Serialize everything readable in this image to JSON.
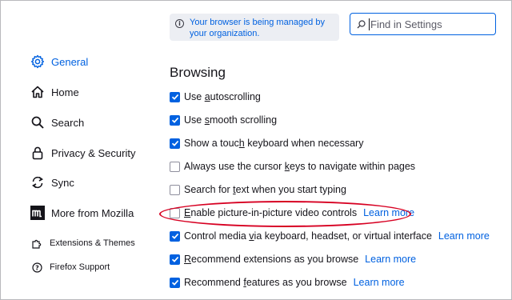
{
  "banner": {
    "text": "Your browser is being managed by your organization."
  },
  "search": {
    "placeholder": "Find in Settings"
  },
  "sidebar": {
    "items": [
      {
        "label": "General",
        "icon": "gear-icon",
        "selected": true
      },
      {
        "label": "Home",
        "icon": "home-icon"
      },
      {
        "label": "Search",
        "icon": "search-icon"
      },
      {
        "label": "Privacy & Security",
        "icon": "lock-icon"
      },
      {
        "label": "Sync",
        "icon": "sync-icon"
      },
      {
        "label": "More from Mozilla",
        "icon": "mozilla-icon"
      }
    ],
    "footer": [
      {
        "label": "Extensions & Themes",
        "icon": "puzzle-icon"
      },
      {
        "label": "Firefox Support",
        "icon": "help-icon"
      }
    ]
  },
  "browsing": {
    "heading": "Browsing",
    "options": [
      {
        "pre": "Use ",
        "key": "a",
        "post": "utoscrolling",
        "checked": true
      },
      {
        "pre": "Use ",
        "key": "s",
        "post": "mooth scrolling",
        "checked": true
      },
      {
        "pre": "Show a touc",
        "key": "h",
        "post": " keyboard when necessary",
        "checked": true
      },
      {
        "pre": "Always use the cursor ",
        "key": "k",
        "post": "eys to navigate within pages",
        "checked": false
      },
      {
        "pre": "Search for ",
        "key": "t",
        "post": "ext when you start typing",
        "checked": false
      },
      {
        "pre": "",
        "key": "E",
        "post": "nable picture-in-picture video controls",
        "checked": false,
        "learn": "Learn more"
      },
      {
        "pre": "Control media ",
        "key": "v",
        "post": "ia keyboard, headset, or virtual interface",
        "checked": true,
        "learn": "Learn more"
      },
      {
        "pre": "",
        "key": "R",
        "post": "ecommend extensions as you browse",
        "checked": true,
        "learn": "Learn more"
      },
      {
        "pre": "Recommend ",
        "key": "f",
        "post": "eatures as you browse",
        "checked": true,
        "learn": "Learn more"
      }
    ]
  },
  "colors": {
    "accent": "#0061e0",
    "highlight": "#d70022"
  }
}
